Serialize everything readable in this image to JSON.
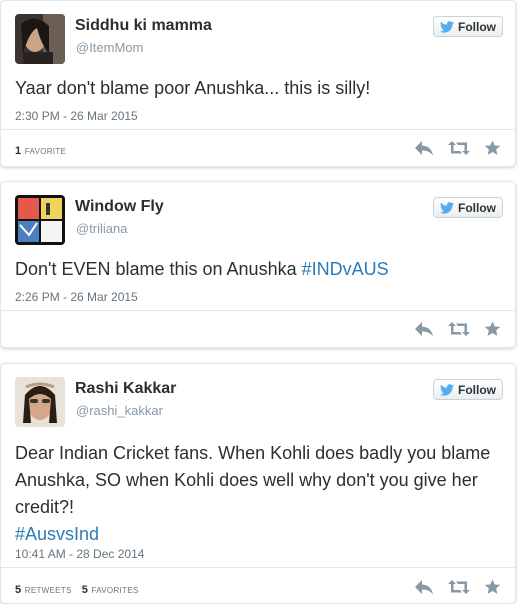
{
  "colors": {
    "text": "#292f33",
    "secondary": "#8899a6",
    "link": "#2b7bb9",
    "twitter_bird": "#55acee",
    "action_icon": "#8899a6"
  },
  "tweets": [
    {
      "display_name": "Siddhu ki mamma",
      "handle": "@ItemMom",
      "follow_label": "Follow",
      "text": "Yaar don't blame poor Anushka... this is silly!",
      "hashtag": "",
      "timestamp": "2:30 PM - 26 Mar 2015",
      "retweets_count": "",
      "retweets_label": "",
      "favorites_count": "1",
      "favorites_label": "FAVORITE",
      "icons": [
        "reply-icon",
        "retweet-icon",
        "favorite-icon"
      ]
    },
    {
      "display_name": "Window Fly",
      "handle": "@triliana",
      "follow_label": "Follow",
      "text": "Don't EVEN blame this on Anushka ",
      "hashtag": "#INDvAUS",
      "timestamp": "2:26 PM - 26 Mar 2015",
      "icons": [
        "reply-icon",
        "retweet-icon",
        "favorite-icon"
      ]
    },
    {
      "display_name": "Rashi Kakkar",
      "handle": "@rashi_kakkar",
      "follow_label": "Follow",
      "text": "Dear Indian Cricket fans. When Kohli does badly you blame Anushka, SO when Kohli does well why don't you give her credit?!",
      "hashtag": "#AusvsInd",
      "timestamp": "10:41 AM - 28 Dec 2014",
      "retweets_count": "5",
      "retweets_label": "RETWEETS",
      "favorites_count": "5",
      "favorites_label": "FAVORITES",
      "icons": [
        "reply-icon",
        "retweet-icon",
        "favorite-icon"
      ]
    }
  ]
}
